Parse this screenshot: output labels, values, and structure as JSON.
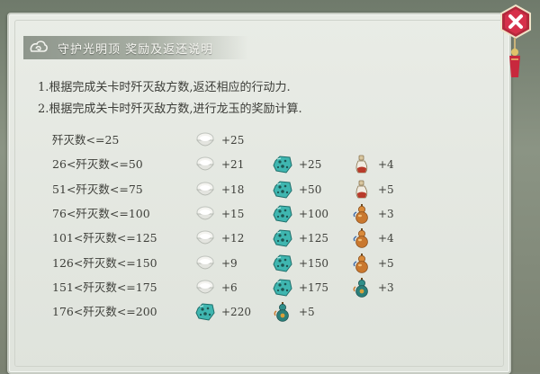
{
  "dialog": {
    "title": "守护光明顶 奖励及返还说明",
    "close_icon": "close-x-icon",
    "emblem_icon": "cloud-scroll-icon"
  },
  "rules": [
    "1.根据完成关卡时歼灭敌方数,返还相应的行动力.",
    "2.根据完成关卡时歼灭敌方数,进行龙玉的奖励计算."
  ],
  "reward_table": [
    {
      "condition": "歼灭数<=25",
      "rewards": [
        {
          "icon": "rice-bowl-icon",
          "amount": "+25"
        }
      ]
    },
    {
      "condition": "26<歼灭数<=50",
      "rewards": [
        {
          "icon": "rice-bowl-icon",
          "amount": "+21"
        },
        {
          "icon": "jade-stone-icon",
          "amount": "+25"
        },
        {
          "icon": "red-potion-icon",
          "amount": "+4"
        }
      ]
    },
    {
      "condition": "51<歼灭数<=75",
      "rewards": [
        {
          "icon": "rice-bowl-icon",
          "amount": "+18"
        },
        {
          "icon": "jade-stone-icon",
          "amount": "+50"
        },
        {
          "icon": "red-potion-icon",
          "amount": "+5"
        }
      ]
    },
    {
      "condition": "76<歼灭数<=100",
      "rewards": [
        {
          "icon": "rice-bowl-icon",
          "amount": "+15"
        },
        {
          "icon": "jade-stone-icon",
          "amount": "+100"
        },
        {
          "icon": "gourd-icon",
          "amount": "+3"
        }
      ]
    },
    {
      "condition": "101<歼灭数<=125",
      "rewards": [
        {
          "icon": "rice-bowl-icon",
          "amount": "+12"
        },
        {
          "icon": "jade-stone-icon",
          "amount": "+125"
        },
        {
          "icon": "gourd-icon",
          "amount": "+4"
        }
      ]
    },
    {
      "condition": "126<歼灭数<=150",
      "rewards": [
        {
          "icon": "rice-bowl-icon",
          "amount": "+9"
        },
        {
          "icon": "jade-stone-icon",
          "amount": "+150"
        },
        {
          "icon": "gourd-icon",
          "amount": "+5"
        }
      ]
    },
    {
      "condition": "151<歼灭数<=175",
      "rewards": [
        {
          "icon": "rice-bowl-icon",
          "amount": "+6"
        },
        {
          "icon": "jade-stone-icon",
          "amount": "+175"
        },
        {
          "icon": "teal-gourd-icon",
          "amount": "+3"
        }
      ]
    },
    {
      "condition": "176<歼灭数<=200",
      "rewards": [
        {
          "icon": "jade-stone-icon",
          "amount": "+220"
        },
        {
          "icon": "teal-gourd-icon",
          "amount": "+5"
        }
      ]
    }
  ],
  "colors": {
    "panel_bg": "#e4e7e1",
    "title_bar": "#97a094",
    "close_button": "#d6304a",
    "jade": "#3fb6b0",
    "potion": "#b83b2b",
    "gourd": "#c9782f"
  }
}
